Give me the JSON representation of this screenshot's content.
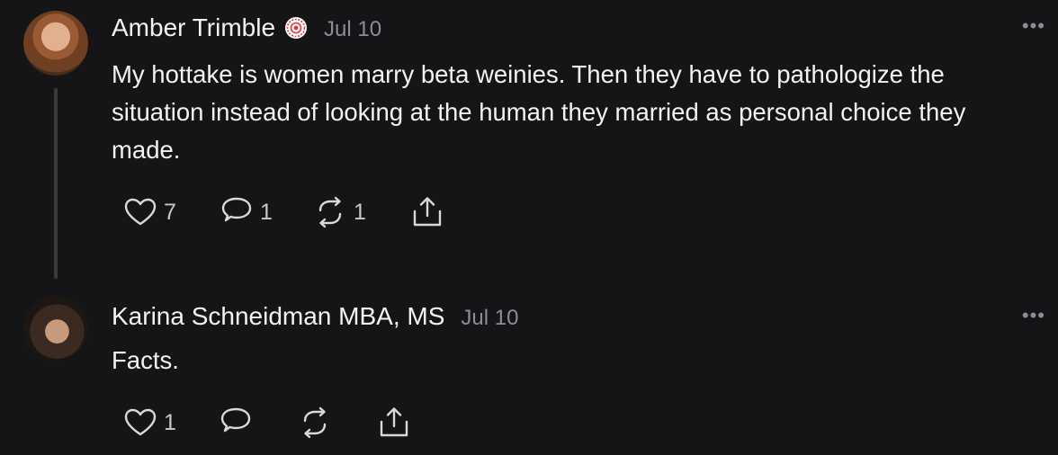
{
  "posts": [
    {
      "author": "Amber Trimble",
      "time": "Jul 10",
      "text": "My hottake is women marry beta weinies. Then they have to pathologize the situation instead of looking at the human they married as personal choice they made.",
      "likes": "7",
      "replies": "1",
      "reposts": "1",
      "more": "•••",
      "badge_color": "#d9383a"
    },
    {
      "author": "Karina Schneidman MBA, MS",
      "time": "Jul 10",
      "text": "Facts.",
      "likes": "1",
      "replies": "",
      "reposts": "",
      "more": "•••"
    }
  ],
  "colors": {
    "background": "#151517",
    "text": "#f3f3f3",
    "muted": "#8d8d93",
    "thread_line": "#3a3a3c"
  }
}
